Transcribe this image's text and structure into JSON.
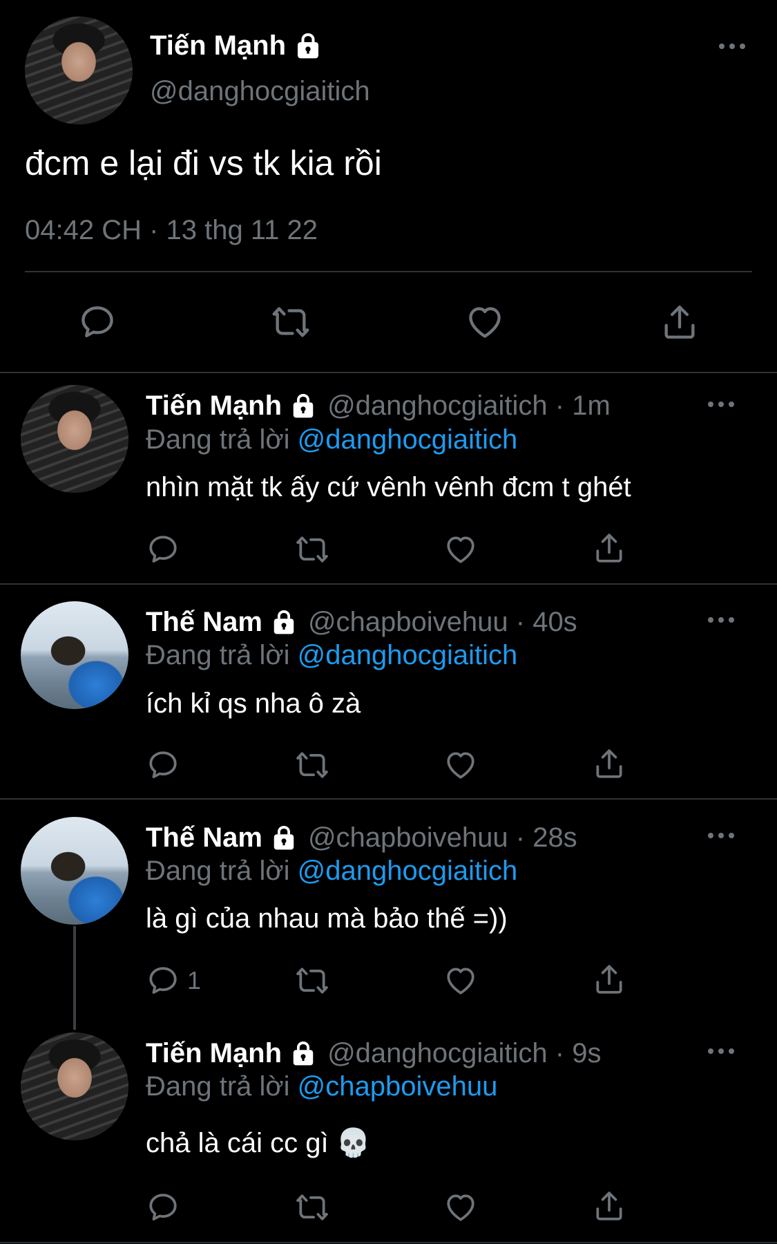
{
  "main_tweet": {
    "name": "Tiến Mạnh",
    "handle": "@danghocgiaitich",
    "text": "đcm e lại đi vs tk kia rồi",
    "timestamp": "04:42 CH · 13 thg 11 22",
    "avatar": "tien-manh-photo"
  },
  "replies": [
    {
      "name": "Tiến Mạnh",
      "handle": "@danghocgiaitich · 1m",
      "replying_label": "Đang trả lời",
      "replying_to": "@danghocgiaitich",
      "text": "nhìn mặt tk ấy cứ vênh vênh đcm t ghét",
      "reply_count": ""
    },
    {
      "name": "Thế Nam",
      "handle": "@chapboivehuu · 40s",
      "replying_label": "Đang trả lời",
      "replying_to": "@danghocgiaitich",
      "text": "ích kỉ qs nha ô zà",
      "reply_count": ""
    },
    {
      "name": "Thế Nam",
      "handle": "@chapboivehuu · 28s",
      "replying_label": "Đang trả lời",
      "replying_to": "@danghocgiaitich",
      "text": "là gì của nhau mà bảo thế =))",
      "reply_count": "1"
    },
    {
      "name": "Tiến Mạnh",
      "handle": "@danghocgiaitich · 9s",
      "replying_label": "Đang trả lời",
      "replying_to": "@chapboivehuu",
      "text": "chả là cái cc gì 💀",
      "reply_count": ""
    }
  ],
  "icons": {
    "reply": "reply-icon",
    "retweet": "retweet-icon",
    "like": "heart-icon",
    "share": "share-icon",
    "more": "more-icon",
    "lock": "lock-icon"
  },
  "colors": {
    "background": "#000000",
    "text": "#ffffff",
    "muted": "#6e7479",
    "link": "#1d9bf0",
    "divider": "#2f3336"
  }
}
